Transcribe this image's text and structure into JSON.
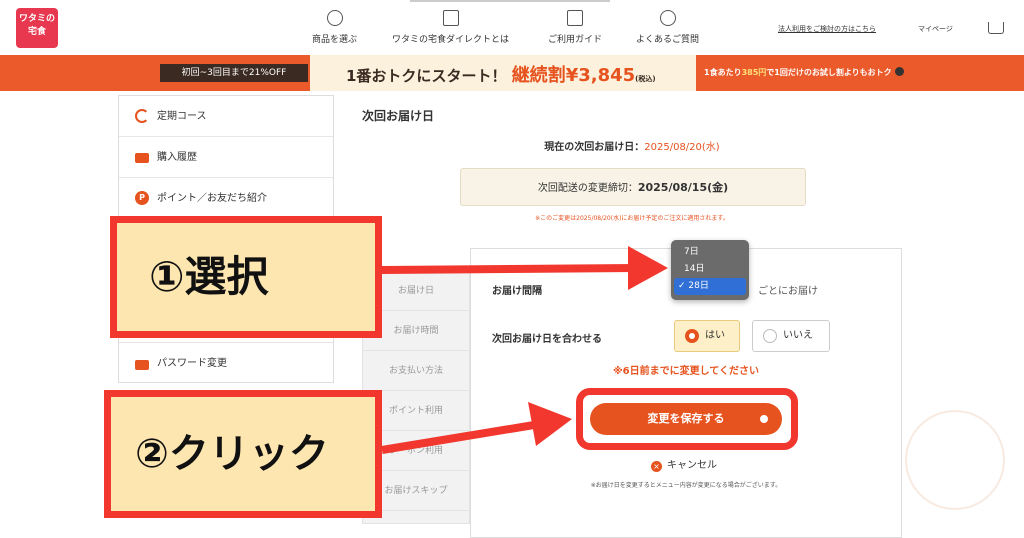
{
  "header": {
    "logo_text": "ワタミの宅食",
    "nav": [
      {
        "label": "商品を選ぶ",
        "icon": "search-icon"
      },
      {
        "label": "ワタミの宅食ダイレクトとは",
        "icon": "home-icon"
      },
      {
        "label": "ご利用ガイド",
        "icon": "guide-icon"
      },
      {
        "label": "よくあるご質問",
        "icon": "faq-icon"
      }
    ],
    "corp_link": "法人利用をご検討の方はこちら",
    "mypage": "マイページ",
    "cart_icon": "cart-icon"
  },
  "banner": {
    "left_badge": "初回~3回目まで21%OFF",
    "main_text": "1番おトクにスタート！",
    "accent_label": "継続割",
    "price": "¥3,845",
    "price_note": "(税込)",
    "right_text_1": "1食あたり",
    "right_highlight": "385円",
    "right_text_2": "で1回だけのお試し割よりもおトク"
  },
  "sidebar": {
    "items": [
      {
        "label": "定期コース",
        "icon": "cycle-icon"
      },
      {
        "label": "購入履歴",
        "icon": "cart-icon"
      },
      {
        "label": "ポイント／お友だち紹介",
        "icon": "point-icon",
        "icon_text": "P"
      }
    ],
    "password": {
      "label": "パスワード変更",
      "icon": "lock-icon"
    }
  },
  "main": {
    "section_title": "次回お届け日",
    "current_label": "現在の次回お届け日：",
    "current_date": "2025/08/20(水)",
    "deadline_label": "次回配送の変更締切：",
    "deadline_date": "2025/08/15(金)",
    "note": "※このご変更は2025/08/20(水)にお届け予定のご注文に適用されます。"
  },
  "tabs": [
    "お届け日",
    "お届け時間",
    "お支払い方法",
    "ポイント利用",
    "クーポン利用",
    "お届けスキップ"
  ],
  "form": {
    "interval_label": "お届け間隔",
    "interval_options": [
      "7日",
      "14日",
      "28日"
    ],
    "interval_selected": "28日",
    "interval_suffix": "ごとにお届け",
    "align_label": "次回お届け日を合わせる",
    "yes_label": "はい",
    "no_label": "いいえ",
    "warning": "※6日前までに変更してください",
    "save_label": "変更を保存する",
    "cancel_label": "キャンセル",
    "footnote": "※お届け日を変更するとメニュー内容が変更になる場合がございます。"
  },
  "annotations": {
    "step1": "①選択",
    "step2": "②クリック"
  },
  "colors": {
    "accent": "#e6531f",
    "annotation_red": "#f2372e",
    "callout_bg": "#fde6b0"
  }
}
